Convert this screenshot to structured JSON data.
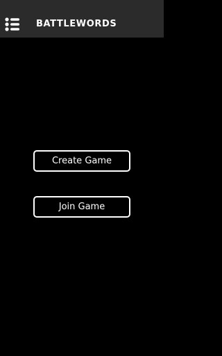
{
  "app_bar": {
    "title": "BATTLEWORDS",
    "menu_icon": "menu-list-icon",
    "background_color": "#2b2b2b"
  },
  "main": {
    "background_color": "#000000",
    "create_game_label": "Create Game",
    "join_game_label": "Join Game",
    "button_border_color": "#ffffff"
  }
}
